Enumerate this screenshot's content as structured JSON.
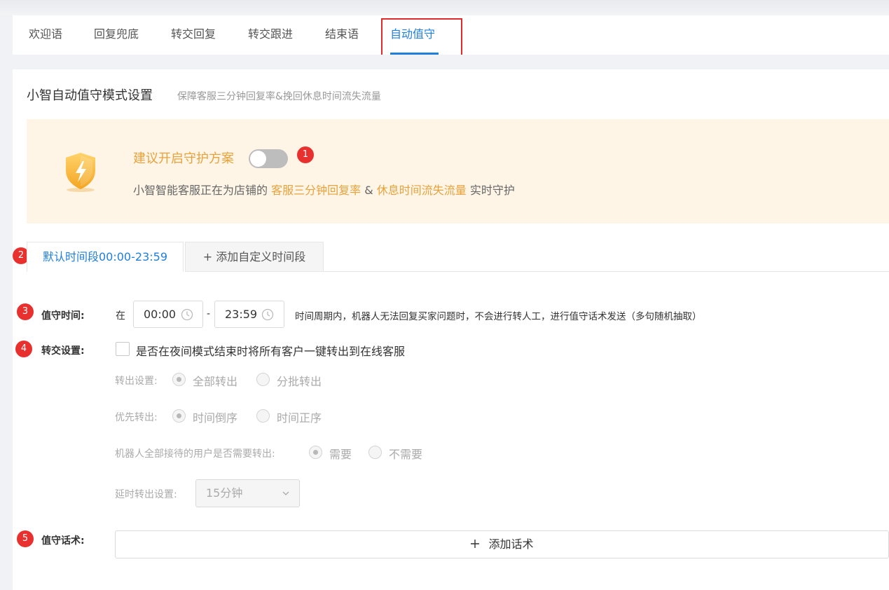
{
  "tabs": [
    {
      "label": "欢迎语",
      "active": false
    },
    {
      "label": "回复兜底",
      "active": false
    },
    {
      "label": "转交回复",
      "active": false
    },
    {
      "label": "转交跟进",
      "active": false
    },
    {
      "label": "结束语",
      "active": false
    },
    {
      "label": "自动值守",
      "active": true
    }
  ],
  "header": {
    "title": "小智自动值守模式设置",
    "subtitle": "保障客服三分钟回复率&挽回休息时间流失流量"
  },
  "banner": {
    "icon": "shield-lightning-icon",
    "title": "建议开启守护方案",
    "toggle_on": false,
    "desc_prefix": "小智智能客服正在为店铺的",
    "desc_highlight1": "客服三分钟回复率",
    "desc_amp": "&",
    "desc_highlight2": "休息时间流失流量",
    "desc_suffix": "实时守护"
  },
  "badges": [
    "1",
    "2",
    "3",
    "4",
    "5"
  ],
  "time_tabs": {
    "default_label": "默认时间段00:00-23:59",
    "add_label": "+ 添加自定义时间段"
  },
  "duty_time": {
    "label": "值守时间:",
    "prefix": "在",
    "start": "00:00",
    "separator": "-",
    "end": "23:59",
    "note": "时间周期内，机器人无法回复买家问题时，不会进行转人工，进行值守话术发送（多句随机抽取）"
  },
  "transfer": {
    "label": "转交设置:",
    "checkbox_label": "是否在夜间模式结束时将所有客户一键转出到在线客服",
    "checked": false,
    "out_setting": {
      "label": "转出设置:",
      "options": [
        "全部转出",
        "分批转出"
      ],
      "selected": 0
    },
    "priority": {
      "label": "优先转出:",
      "options": [
        "时间倒序",
        "时间正序"
      ],
      "selected": 0
    },
    "robot_users": {
      "label": "机器人全部接待的用户是否需要转出:",
      "options": [
        "需要",
        "不需要"
      ],
      "selected": 0
    },
    "delay": {
      "label": "延时转出设置:",
      "value": "15分钟"
    }
  },
  "script": {
    "label": "值守话术:",
    "add_label": "添加话术",
    "add_icon": "plus-icon"
  },
  "colors": {
    "accent": "#1f7fdc",
    "warning": "#e8a23b",
    "badge": "#e8312f",
    "banner_bg": "#fef5e7"
  }
}
